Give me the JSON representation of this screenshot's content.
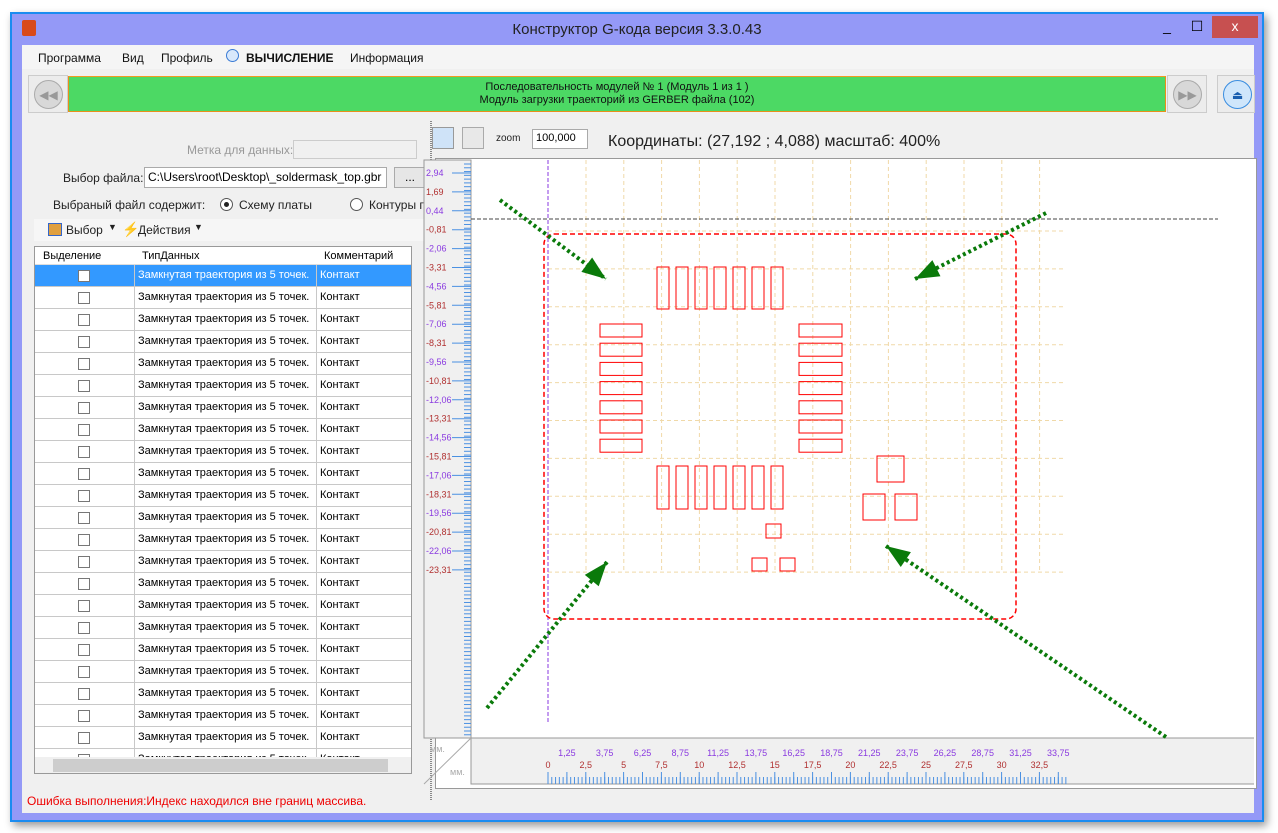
{
  "window": {
    "title": "Конструктор G-кода версия 3.3.0.43",
    "minimize": "_",
    "maximize": "☐",
    "close": "x"
  },
  "menu": [
    "Программа",
    "Вид",
    "Профиль",
    "ВЫЧИСЛЕНИЕ",
    "Информация"
  ],
  "banner": {
    "line1": "Последовательность модулей № 1 (Модуль 1 из 1 )",
    "line2": "Модуль загрузки траекторий из GERBER файла (102)"
  },
  "form": {
    "data_label": "Метка для данных:",
    "data_value": "",
    "file_label": "Выбор файла:",
    "file_value": "C:\\Users\\root\\Desktop\\_soldermask_top.gbr",
    "browse": "...",
    "contains_label": "Выбраный файл содержит:",
    "opt1": "Схему платы",
    "opt2": "Контуры пл",
    "selected": "opt1"
  },
  "toolbar": {
    "select": "Выбор",
    "actions": "Действия"
  },
  "table": {
    "headers": [
      "Выделение",
      "ТипДанных",
      "Комментарий"
    ],
    "row_type": "Замкнутая траектория из 5 точек.",
    "row_comment": "Контакт",
    "visible_rows": 23,
    "selected_row": 0
  },
  "viewer": {
    "zoom_label": "zoom",
    "zoom_value": "100,000",
    "coords": "Координаты: (27,192 ; 4,088) масштаб: 400%",
    "unit_top": "мм.",
    "unit_bottom": "мм."
  },
  "ruler_y": [
    "2,94",
    "1,69",
    "0,44",
    "-0,81",
    "-2,06",
    "-3,31",
    "-4,56",
    "-5,81",
    "-7,06",
    "-8,31",
    "-9,56",
    "-10,81",
    "-12,06",
    "-13,31",
    "-14,56",
    "-15,81",
    "-17,06",
    "-18,31",
    "-19,56",
    "-20,81",
    "-22,06",
    "-23,31"
  ],
  "ruler_x_top": [
    "1,25",
    "3,75",
    "6,25",
    "8,75",
    "11,25",
    "13,75",
    "16,25",
    "18,75",
    "21,25",
    "23,75",
    "26,25",
    "28,75",
    "31,25",
    "33,75"
  ],
  "ruler_x_bottom": [
    "0",
    "2,5",
    "5",
    "7,5",
    "10",
    "12,5",
    "15",
    "17,5",
    "20",
    "22,5",
    "25",
    "27,5",
    "30",
    "32,5"
  ],
  "status": "Ошибка выполнения:Индекс находился вне границ массива.",
  "colors": {
    "banner": "#4cd964",
    "pads": "#ff0000",
    "arrows": "#0a7a0a",
    "grid": "#f0d9a8",
    "selection": "#3399ff",
    "error": "#ee0000"
  }
}
